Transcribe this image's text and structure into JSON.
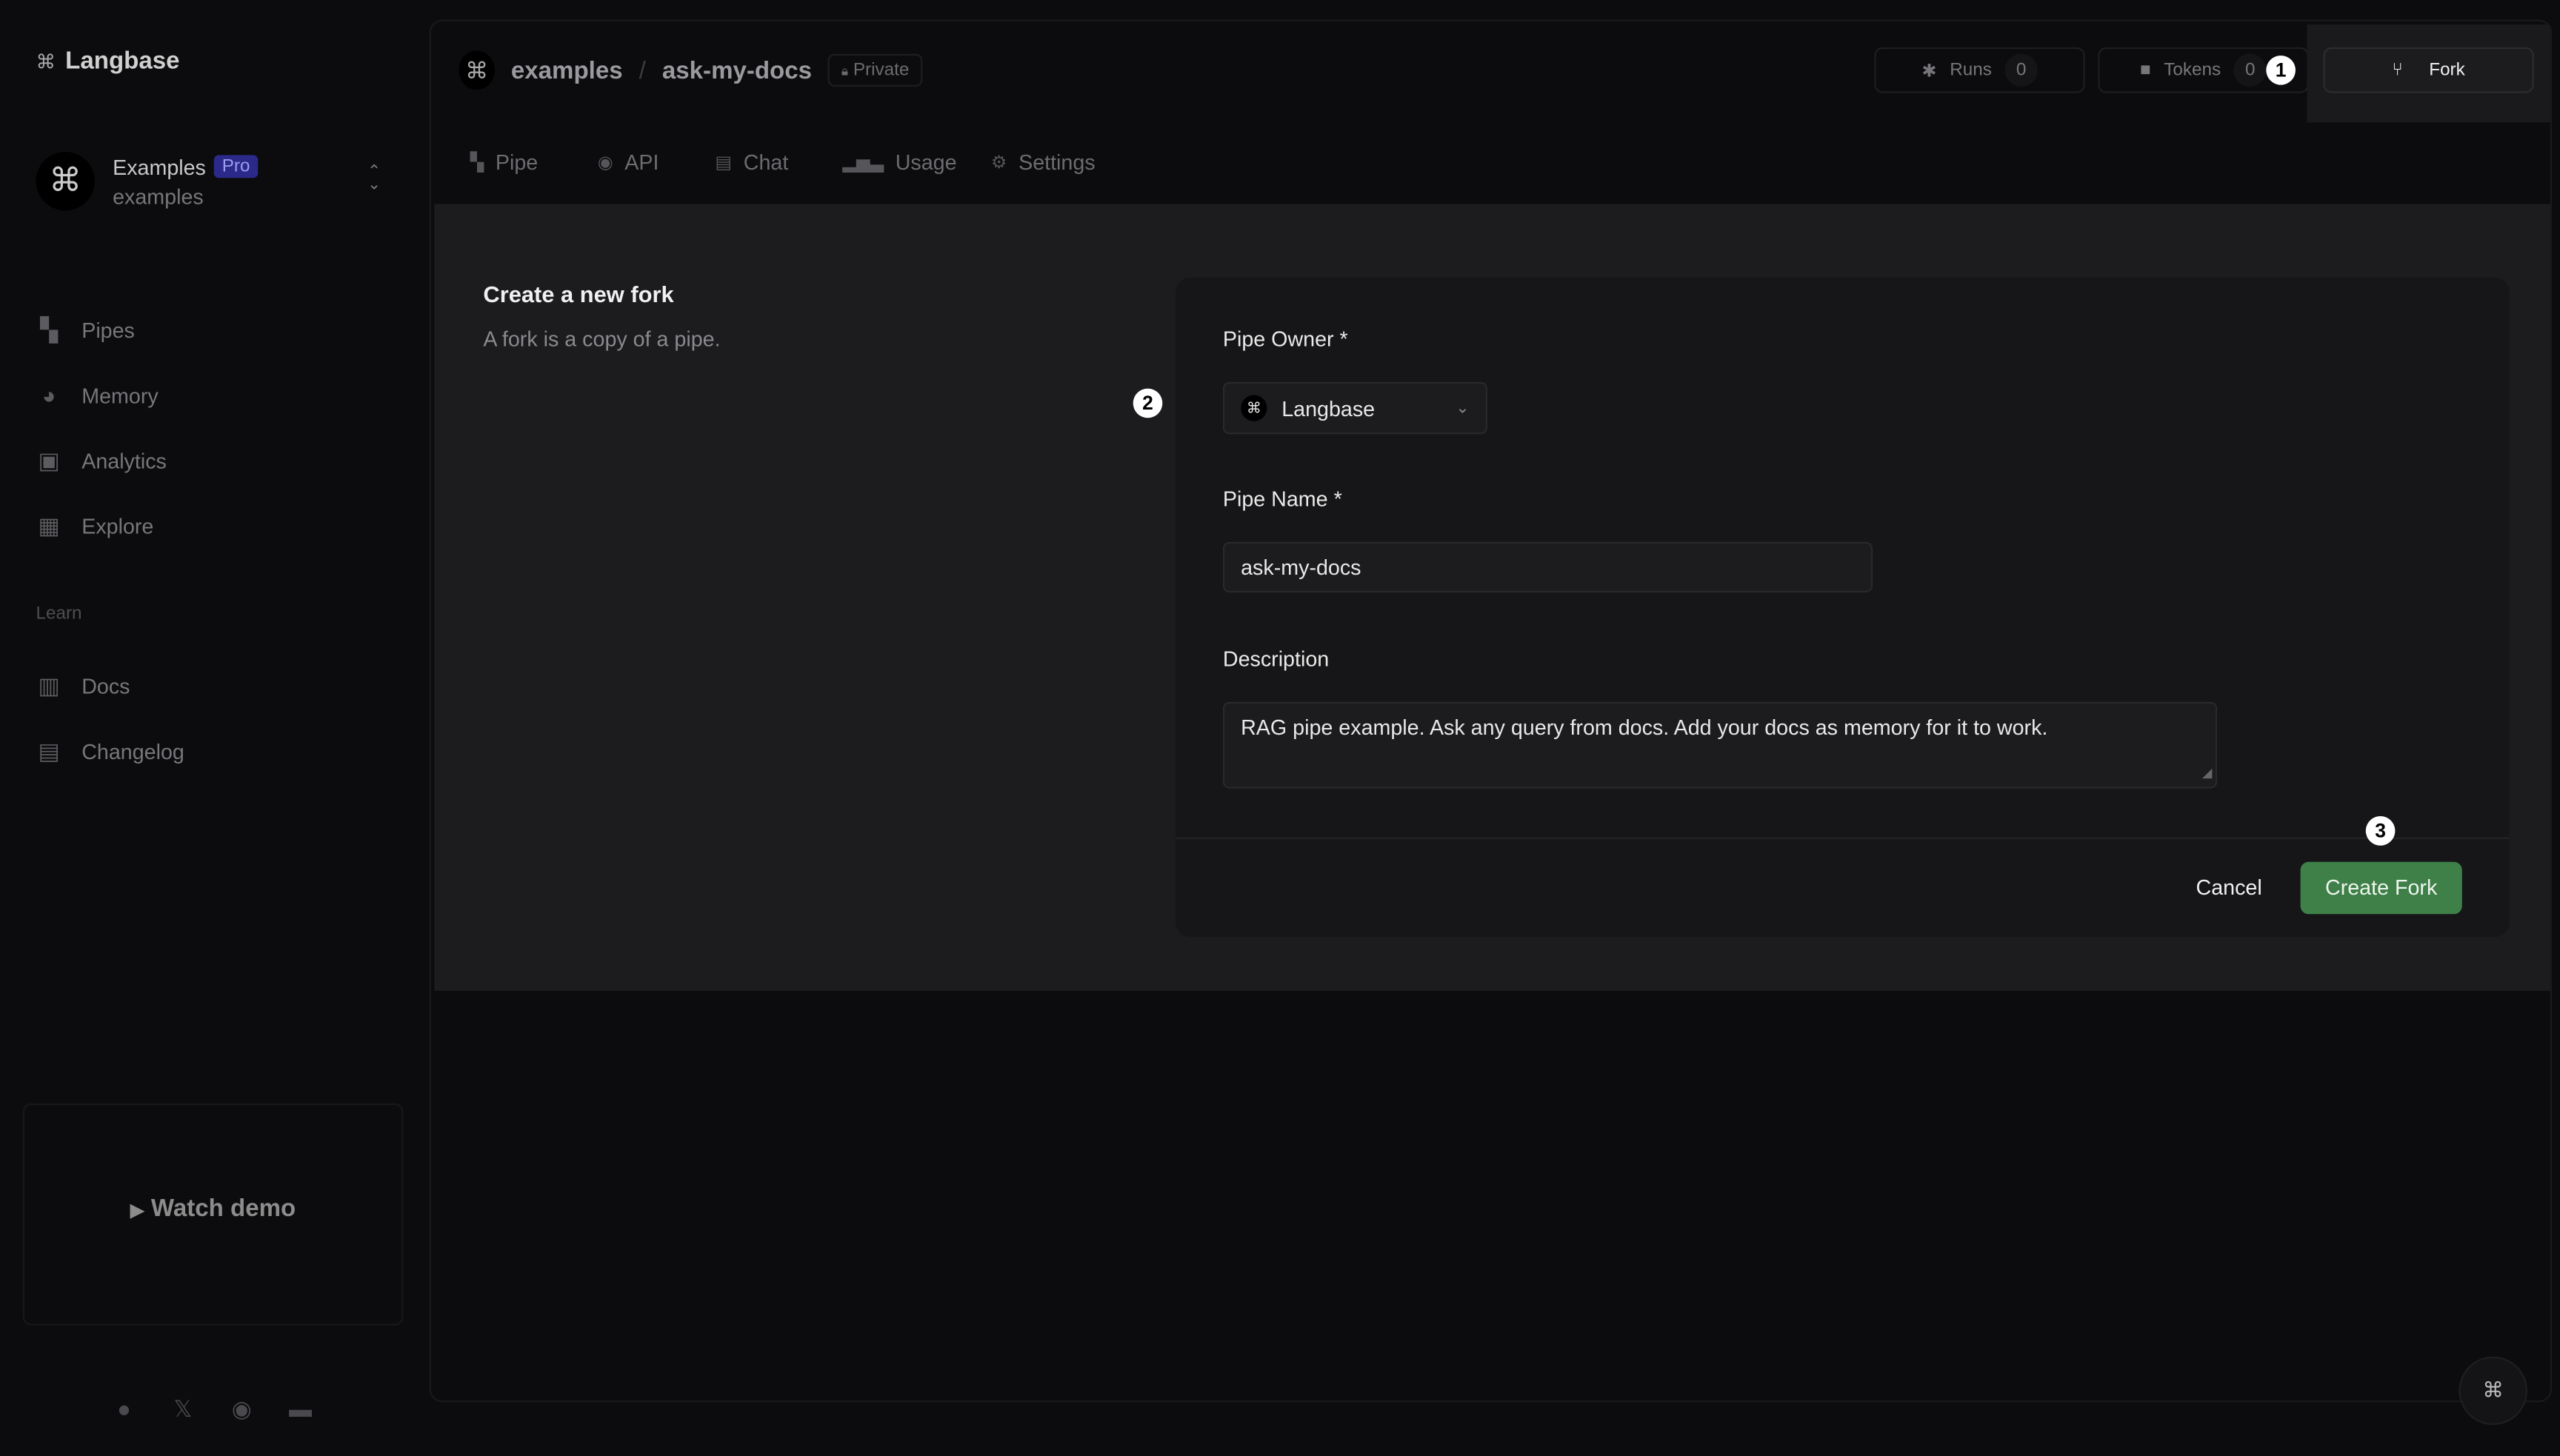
{
  "sidebar": {
    "brand": "Langbase",
    "workspace": {
      "name": "Examples",
      "badge": "Pro",
      "slug": "examples"
    },
    "items": [
      {
        "label": "Pipes",
        "icon": "pipe-icon"
      },
      {
        "label": "Memory",
        "icon": "memory-icon"
      },
      {
        "label": "Analytics",
        "icon": "analytics-icon"
      },
      {
        "label": "Explore",
        "icon": "explore-icon"
      }
    ],
    "learn_heading": "Learn",
    "learn_items": [
      {
        "label": "Docs",
        "icon": "book-icon"
      },
      {
        "label": "Changelog",
        "icon": "changelog-icon"
      }
    ],
    "demo": {
      "label": "Watch demo"
    },
    "social": [
      "github-icon",
      "x-icon",
      "discord-icon",
      "browser-icon"
    ]
  },
  "header": {
    "owner": "examples",
    "separator": "/",
    "pipe": "ask-my-docs",
    "visibility": "Private",
    "runs_label": "Runs",
    "runs_count": "0",
    "tokens_label": "Tokens",
    "tokens_count": "0",
    "fork_label": "Fork"
  },
  "tabs": [
    {
      "label": "Pipe"
    },
    {
      "label": "API"
    },
    {
      "label": "Chat"
    },
    {
      "label": "Usage"
    },
    {
      "label": "Settings"
    }
  ],
  "fork_form": {
    "title": "Create a new fork",
    "subtitle": "A fork is a copy of a pipe.",
    "owner_label": "Pipe Owner *",
    "owner_value": "Langbase",
    "name_label": "Pipe Name *",
    "name_value": "ask-my-docs",
    "description_label": "Description",
    "description_value": "RAG pipe example. Ask any query from docs. Add your docs as memory for it to work.",
    "cancel_label": "Cancel",
    "submit_label": "Create Fork"
  },
  "markers": [
    "1",
    "2",
    "3"
  ],
  "colors": {
    "accent_green": "#3e8048",
    "pro_badge": "#2b2a8a",
    "background": "#0c0c0e"
  }
}
